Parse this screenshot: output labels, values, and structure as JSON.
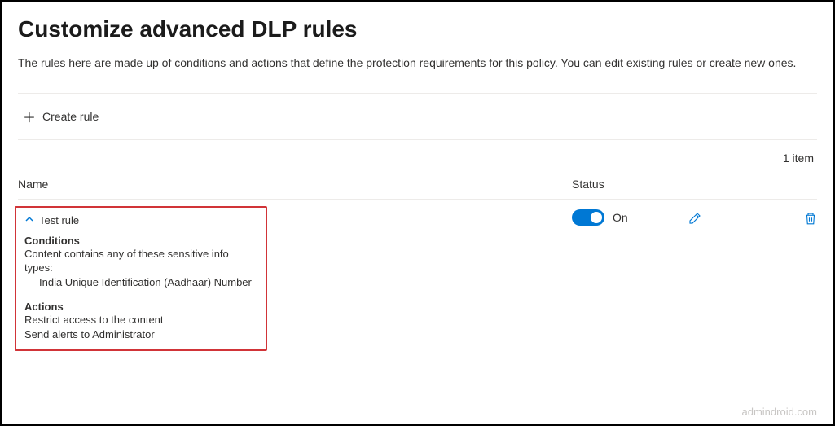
{
  "header": {
    "title": "Customize advanced DLP rules",
    "description": "The rules here are made up of conditions and actions that define the protection requirements for this policy. You can edit existing rules or create new ones."
  },
  "toolbar": {
    "create_label": "Create rule"
  },
  "list": {
    "item_count": "1 item",
    "columns": {
      "name": "Name",
      "status": "Status"
    }
  },
  "rule": {
    "name": "Test rule",
    "conditions_title": "Conditions",
    "conditions_line": "Content contains any of these sensitive info types:",
    "conditions_item": "India Unique Identification (Aadhaar) Number",
    "actions_title": "Actions",
    "action_1": "Restrict access to the content",
    "action_2": "Send alerts to Administrator",
    "status_label": "On"
  },
  "watermark": "admindroid.com"
}
